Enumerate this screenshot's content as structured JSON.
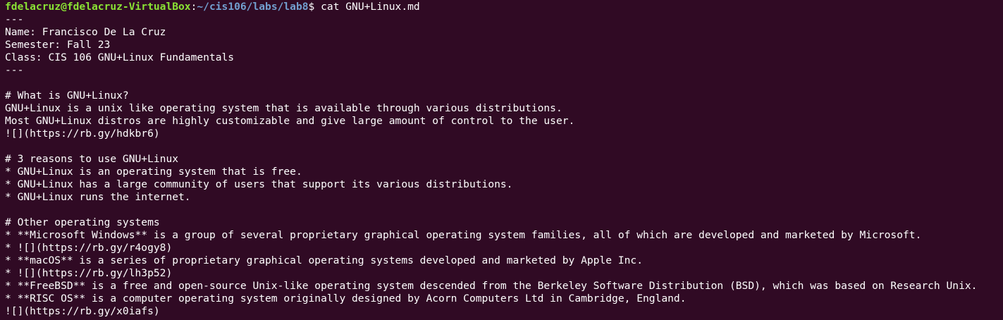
{
  "terminal": {
    "prompt": {
      "user_host": "fdelacruz@fdelacruz-VirtualBox",
      "separator": ":",
      "path": "~/cis106/labs/lab8",
      "dollar": "$ ",
      "command": "cat GNU+Linux.md"
    },
    "lines": [
      "---",
      "Name: Francisco De La Cruz",
      "Semester: Fall 23",
      "Class: CIS 106 GNU+Linux Fundamentals",
      "---",
      "",
      "# What is GNU+Linux?",
      "GNU+Linux is a unix like operating system that is available through various distributions.",
      "Most GNU+Linux distros are highly customizable and give large amount of control to the user.",
      "![](https://rb.gy/hdkbr6)",
      "",
      "# 3 reasons to use GNU+Linux",
      "* GNU+Linux is an operating system that is free.",
      "* GNU+Linux has a large community of users that support its various distributions.",
      "* GNU+Linux runs the internet.",
      "",
      "# Other operating systems",
      "* **Microsoft Windows** is a group of several proprietary graphical operating system families, all of which are developed and marketed by Microsoft.",
      "* ![](https://rb.gy/r4ogy8)",
      "* **macOS** is a series of proprietary graphical operating systems developed and marketed by Apple Inc.",
      "* ![](https://rb.gy/lh3p52)",
      "* **FreeBSD** is a free and open-source Unix-like operating system descended from the Berkeley Software Distribution (BSD), which was based on Research Unix.",
      "* **RISC OS** is a computer operating system originally designed by Acorn Computers Ltd in Cambridge, England.",
      "![](https://rb.gy/x0iafs)"
    ]
  }
}
